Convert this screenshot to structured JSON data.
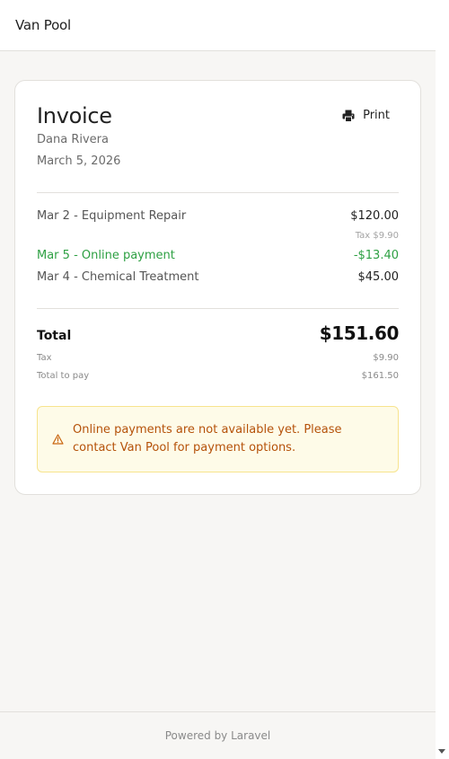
{
  "header": {
    "brand": "Van Pool"
  },
  "invoice": {
    "title": "Invoice",
    "customer": "Dana Rivera",
    "date": "March 5, 2026",
    "print_label": "Print",
    "lines": [
      {
        "description": "Mar 2 - Equipment Repair",
        "amount": "$120.00",
        "tax_note": "Tax $9.90",
        "type": "charge"
      },
      {
        "description": "Mar 5 - Online payment",
        "amount": "-$13.40",
        "type": "payment"
      },
      {
        "description": "Mar 4 - Chemical Treatment",
        "amount": "$45.00",
        "type": "charge"
      }
    ],
    "total_label": "Total",
    "total_amount": "$151.60",
    "tax_label": "Tax",
    "tax_amount": "$9.90",
    "total_to_pay_label": "Total to pay",
    "total_to_pay_amount": "$161.50",
    "alert": {
      "icon": "warning-icon",
      "message": "Online payments are not available yet. Please contact Van Pool for payment options."
    }
  },
  "footer": {
    "text": "Powered by Laravel"
  },
  "colors": {
    "payment_green": "#2ea043",
    "alert_text": "#b5520a",
    "alert_bg": "#fefbe8",
    "alert_border": "#f7e48e",
    "page_bg": "#f7f6f4"
  }
}
